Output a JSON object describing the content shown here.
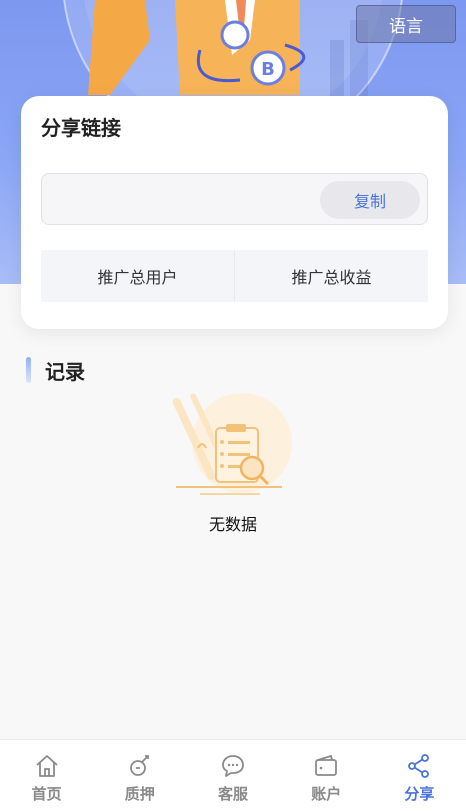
{
  "header": {
    "language_label": "语言"
  },
  "share_card": {
    "title": "分享链接",
    "link_value": "",
    "copy_label": "复制",
    "stats": [
      "推广总用户",
      "推广总收益"
    ]
  },
  "records": {
    "title": "记录",
    "empty_text": "无数据"
  },
  "tabbar": {
    "items": [
      {
        "label": "首页",
        "icon": "home-icon",
        "active": false
      },
      {
        "label": "质押",
        "icon": "pledge-icon",
        "active": false
      },
      {
        "label": "客服",
        "icon": "chat-icon",
        "active": false
      },
      {
        "label": "账户",
        "icon": "wallet-icon",
        "active": false
      },
      {
        "label": "分享",
        "icon": "share-icon",
        "active": true
      }
    ]
  },
  "colors": {
    "accent": "#4a74d8",
    "hero": "#8aa6f5",
    "inactive": "#8a8a8a"
  }
}
